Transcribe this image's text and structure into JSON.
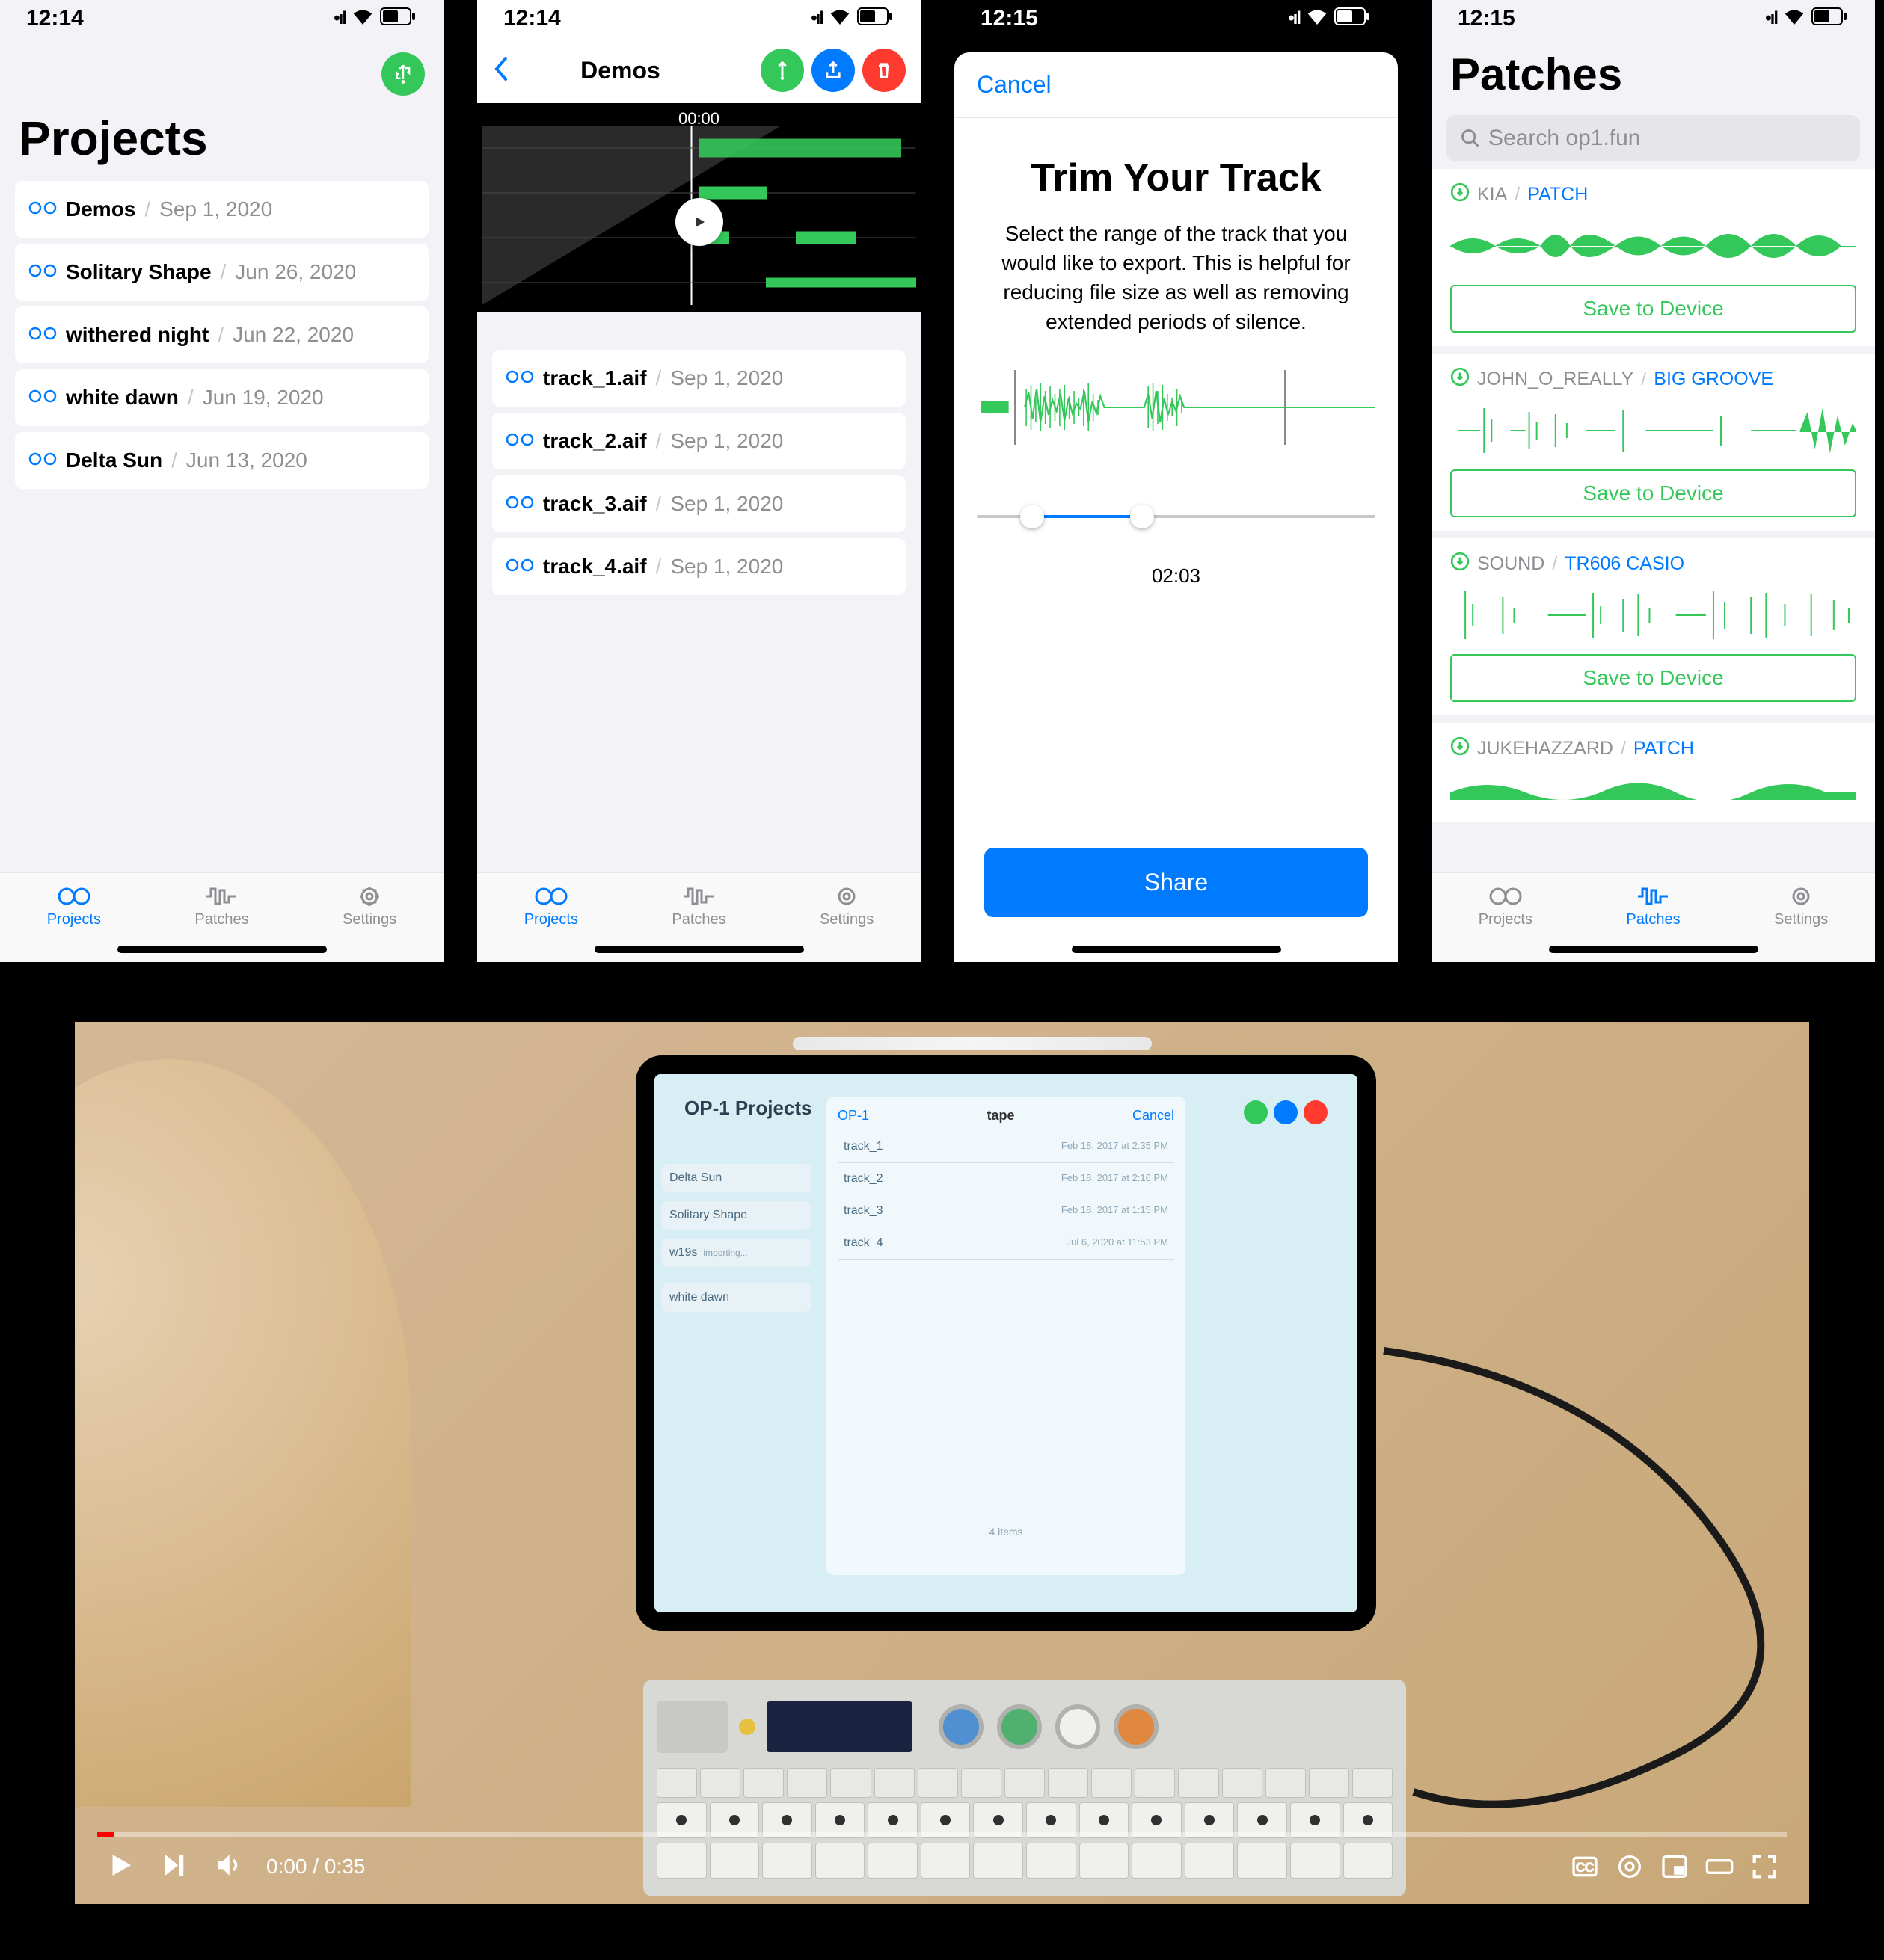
{
  "colors": {
    "accent": "#007aff",
    "green": "#34c759",
    "red": "#ff3b30"
  },
  "phone1": {
    "time": "12:14",
    "title": "Projects",
    "items": [
      {
        "name": "Demos",
        "date": "Sep 1, 2020"
      },
      {
        "name": "Solitary Shape",
        "date": "Jun 26, 2020"
      },
      {
        "name": "withered night",
        "date": "Jun 22, 2020"
      },
      {
        "name": "white dawn",
        "date": "Jun 19, 2020"
      },
      {
        "name": "Delta Sun",
        "date": "Jun 13, 2020"
      }
    ],
    "tabs": {
      "projects": "Projects",
      "patches": "Patches",
      "settings": "Settings"
    }
  },
  "phone2": {
    "time": "12:14",
    "title": "Demos",
    "timestamp": "00:00",
    "tracks": [
      {
        "name": "track_1.aif",
        "date": "Sep 1, 2020"
      },
      {
        "name": "track_2.aif",
        "date": "Sep 1, 2020"
      },
      {
        "name": "track_3.aif",
        "date": "Sep 1, 2020"
      },
      {
        "name": "track_4.aif",
        "date": "Sep 1, 2020"
      }
    ],
    "tabs": {
      "projects": "Projects",
      "patches": "Patches",
      "settings": "Settings"
    }
  },
  "phone3": {
    "time": "12:15",
    "cancel": "Cancel",
    "title": "Trim Your Track",
    "desc": "Select the range of the track that you would like to export. This is helpful for reducing file size as well as removing extended periods of silence.",
    "duration": "02:03",
    "share": "Share"
  },
  "phone4": {
    "time": "12:15",
    "title": "Patches",
    "search_placeholder": "Search op1.fun",
    "save_label": "Save to Device",
    "patches": [
      {
        "user": "KIA",
        "name": "PATCH"
      },
      {
        "user": "JOHN_O_REALLY",
        "name": "BIG GROOVE"
      },
      {
        "user": "SOUND",
        "name": "TR606 CASIO"
      },
      {
        "user": "JUKEHAZZARD",
        "name": "PATCH"
      }
    ],
    "tabs": {
      "projects": "Projects",
      "patches": "Patches",
      "settings": "Settings"
    }
  },
  "ipad": {
    "title": "OP-1 Projects",
    "panel_back": "OP-1",
    "panel_title": "tape",
    "panel_cancel": "Cancel",
    "files": [
      {
        "name": "track_1",
        "meta": "Feb 18, 2017 at 2:35 PM"
      },
      {
        "name": "track_2",
        "meta": "Feb 18, 2017 at 2:16 PM"
      },
      {
        "name": "track_3",
        "meta": "Feb 18, 2017 at 1:15 PM"
      },
      {
        "name": "track_4",
        "meta": "Jul 6, 2020 at 11:53 PM"
      }
    ],
    "footer": "4 items",
    "side": [
      {
        "name": "Delta Sun"
      },
      {
        "name": "Solitary Shape"
      },
      {
        "name": "w19s",
        "sub": "importing..."
      },
      {
        "name": "white dawn"
      }
    ]
  },
  "video": {
    "current": "0:00",
    "total": "0:35"
  }
}
